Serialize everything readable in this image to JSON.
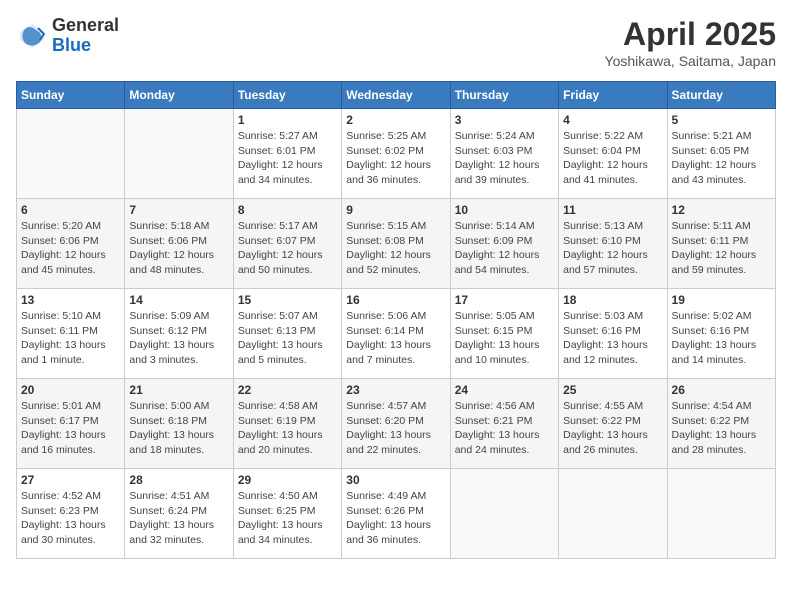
{
  "logo": {
    "general": "General",
    "blue": "Blue"
  },
  "title": {
    "month": "April 2025",
    "location": "Yoshikawa, Saitama, Japan"
  },
  "calendar": {
    "headers": [
      "Sunday",
      "Monday",
      "Tuesday",
      "Wednesday",
      "Thursday",
      "Friday",
      "Saturday"
    ],
    "weeks": [
      [
        {
          "day": "",
          "info": ""
        },
        {
          "day": "",
          "info": ""
        },
        {
          "day": "1",
          "info": "Sunrise: 5:27 AM\nSunset: 6:01 PM\nDaylight: 12 hours and 34 minutes."
        },
        {
          "day": "2",
          "info": "Sunrise: 5:25 AM\nSunset: 6:02 PM\nDaylight: 12 hours and 36 minutes."
        },
        {
          "day": "3",
          "info": "Sunrise: 5:24 AM\nSunset: 6:03 PM\nDaylight: 12 hours and 39 minutes."
        },
        {
          "day": "4",
          "info": "Sunrise: 5:22 AM\nSunset: 6:04 PM\nDaylight: 12 hours and 41 minutes."
        },
        {
          "day": "5",
          "info": "Sunrise: 5:21 AM\nSunset: 6:05 PM\nDaylight: 12 hours and 43 minutes."
        }
      ],
      [
        {
          "day": "6",
          "info": "Sunrise: 5:20 AM\nSunset: 6:06 PM\nDaylight: 12 hours and 45 minutes."
        },
        {
          "day": "7",
          "info": "Sunrise: 5:18 AM\nSunset: 6:06 PM\nDaylight: 12 hours and 48 minutes."
        },
        {
          "day": "8",
          "info": "Sunrise: 5:17 AM\nSunset: 6:07 PM\nDaylight: 12 hours and 50 minutes."
        },
        {
          "day": "9",
          "info": "Sunrise: 5:15 AM\nSunset: 6:08 PM\nDaylight: 12 hours and 52 minutes."
        },
        {
          "day": "10",
          "info": "Sunrise: 5:14 AM\nSunset: 6:09 PM\nDaylight: 12 hours and 54 minutes."
        },
        {
          "day": "11",
          "info": "Sunrise: 5:13 AM\nSunset: 6:10 PM\nDaylight: 12 hours and 57 minutes."
        },
        {
          "day": "12",
          "info": "Sunrise: 5:11 AM\nSunset: 6:11 PM\nDaylight: 12 hours and 59 minutes."
        }
      ],
      [
        {
          "day": "13",
          "info": "Sunrise: 5:10 AM\nSunset: 6:11 PM\nDaylight: 13 hours and 1 minute."
        },
        {
          "day": "14",
          "info": "Sunrise: 5:09 AM\nSunset: 6:12 PM\nDaylight: 13 hours and 3 minutes."
        },
        {
          "day": "15",
          "info": "Sunrise: 5:07 AM\nSunset: 6:13 PM\nDaylight: 13 hours and 5 minutes."
        },
        {
          "day": "16",
          "info": "Sunrise: 5:06 AM\nSunset: 6:14 PM\nDaylight: 13 hours and 7 minutes."
        },
        {
          "day": "17",
          "info": "Sunrise: 5:05 AM\nSunset: 6:15 PM\nDaylight: 13 hours and 10 minutes."
        },
        {
          "day": "18",
          "info": "Sunrise: 5:03 AM\nSunset: 6:16 PM\nDaylight: 13 hours and 12 minutes."
        },
        {
          "day": "19",
          "info": "Sunrise: 5:02 AM\nSunset: 6:16 PM\nDaylight: 13 hours and 14 minutes."
        }
      ],
      [
        {
          "day": "20",
          "info": "Sunrise: 5:01 AM\nSunset: 6:17 PM\nDaylight: 13 hours and 16 minutes."
        },
        {
          "day": "21",
          "info": "Sunrise: 5:00 AM\nSunset: 6:18 PM\nDaylight: 13 hours and 18 minutes."
        },
        {
          "day": "22",
          "info": "Sunrise: 4:58 AM\nSunset: 6:19 PM\nDaylight: 13 hours and 20 minutes."
        },
        {
          "day": "23",
          "info": "Sunrise: 4:57 AM\nSunset: 6:20 PM\nDaylight: 13 hours and 22 minutes."
        },
        {
          "day": "24",
          "info": "Sunrise: 4:56 AM\nSunset: 6:21 PM\nDaylight: 13 hours and 24 minutes."
        },
        {
          "day": "25",
          "info": "Sunrise: 4:55 AM\nSunset: 6:22 PM\nDaylight: 13 hours and 26 minutes."
        },
        {
          "day": "26",
          "info": "Sunrise: 4:54 AM\nSunset: 6:22 PM\nDaylight: 13 hours and 28 minutes."
        }
      ],
      [
        {
          "day": "27",
          "info": "Sunrise: 4:52 AM\nSunset: 6:23 PM\nDaylight: 13 hours and 30 minutes."
        },
        {
          "day": "28",
          "info": "Sunrise: 4:51 AM\nSunset: 6:24 PM\nDaylight: 13 hours and 32 minutes."
        },
        {
          "day": "29",
          "info": "Sunrise: 4:50 AM\nSunset: 6:25 PM\nDaylight: 13 hours and 34 minutes."
        },
        {
          "day": "30",
          "info": "Sunrise: 4:49 AM\nSunset: 6:26 PM\nDaylight: 13 hours and 36 minutes."
        },
        {
          "day": "",
          "info": ""
        },
        {
          "day": "",
          "info": ""
        },
        {
          "day": "",
          "info": ""
        }
      ]
    ]
  }
}
